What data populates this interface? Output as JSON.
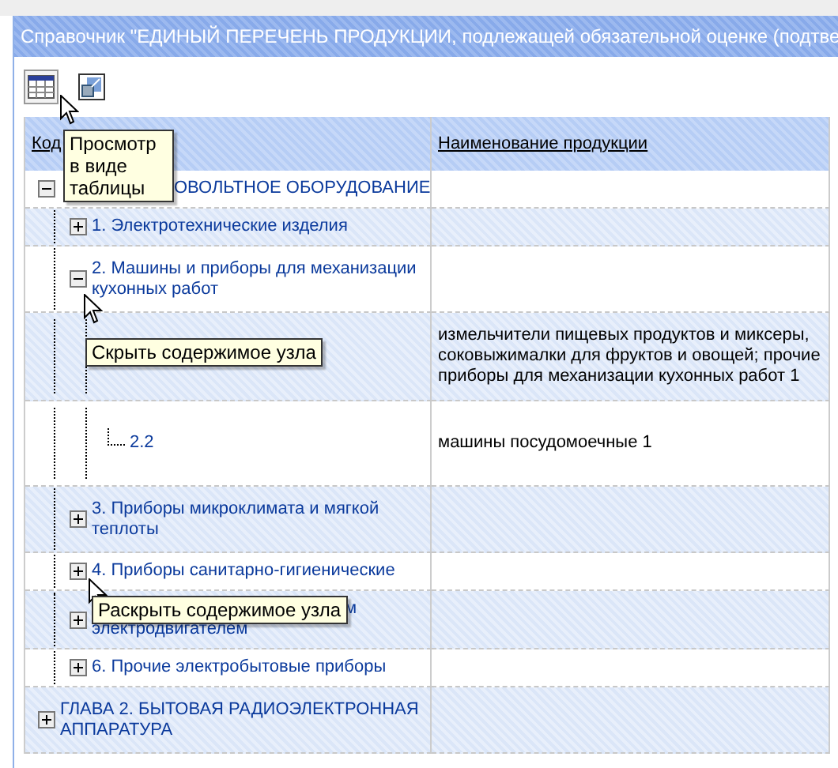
{
  "window": {
    "title": "Справочник \"ЕДИНЫЙ ПЕРЕЧЕНЬ ПРОДУКЦИИ, подлежащей обязательной оценке (подтве"
  },
  "table": {
    "columns": [
      "Код",
      "Наименование продукции"
    ],
    "rows": [
      {
        "code": "ОВОЛЬТНОЕ ОБОРУДОВАНИЕ",
        "expanded": true,
        "children": [
          {
            "code": "1. Электротехнические изделия",
            "expanded": false
          },
          {
            "code": "2. Машины и приборы для механизации кухонных работ",
            "expanded": true,
            "children": [
              {
                "name": "измельчители пищевых продуктов и миксеры, соковыжималки для фруктов и овощей; прочие приборы для механизации кухонных работ 1"
              },
              {
                "code": "2.2",
                "name": "машины посудомоечные 1"
              }
            ]
          },
          {
            "code": "3. Приборы микроклимата и мягкой теплоты",
            "expanded": false
          },
          {
            "code": "4. Приборы санитарно-гигиенические",
            "expanded": false
          },
          {
            "code": "м электродвигателем",
            "expanded": false
          },
          {
            "code": "6. Прочие электробытовые приборы",
            "expanded": false
          }
        ]
      },
      {
        "code": "ГЛАВА 2. БЫТОВАЯ РАДИОЭЛЕКТРОННАЯ АППАРАТУРА",
        "expanded": false
      }
    ]
  },
  "tooltips": [
    {
      "text": "Просмотр в виде таблицы"
    },
    {
      "text": "Скрыть содержимое узла"
    },
    {
      "text": "Раскрыть содержимое узла"
    }
  ]
}
